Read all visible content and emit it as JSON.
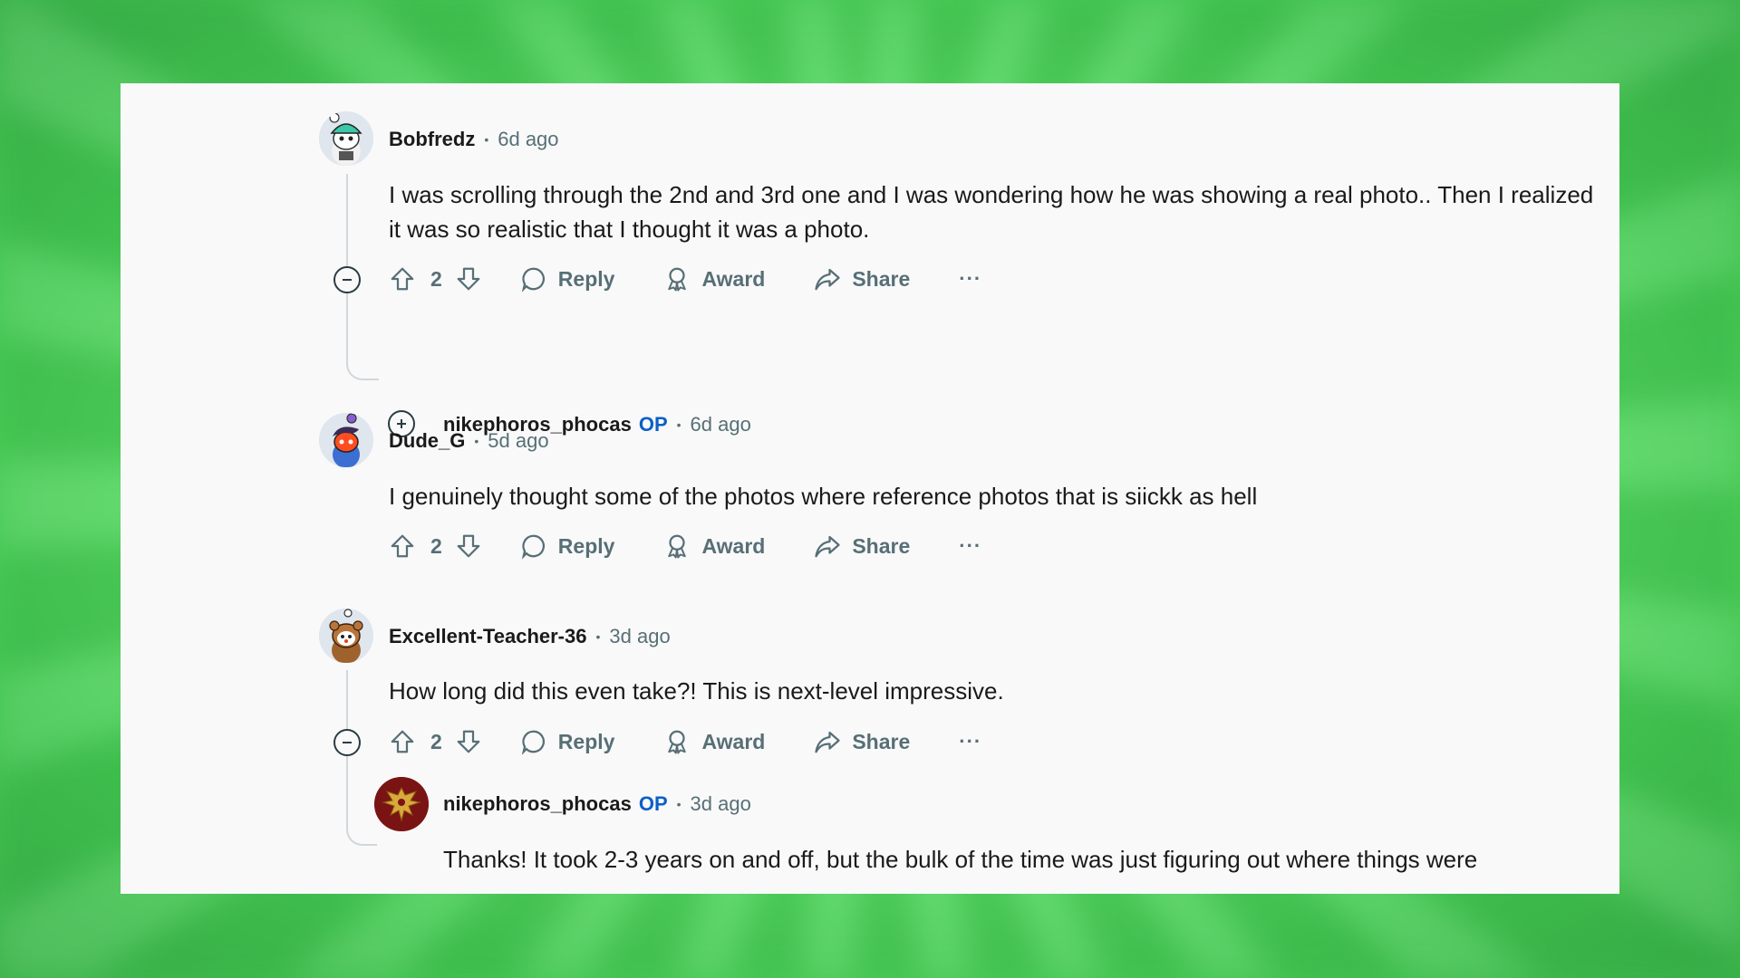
{
  "comments": [
    {
      "username": "Bobfredz",
      "time": "6d ago",
      "text": "I was scrolling through the 2nd and 3rd one and I was wondering how he was showing a real photo.. Then I realized it was so realistic that I thought it was a photo.",
      "votes": "2",
      "avatar_icon": "snoo-avatar-teal-hat-icon"
    },
    {
      "username": "nikephoros_phocas",
      "op_label": "OP",
      "time": "6d ago",
      "collapsed": true
    },
    {
      "username": "Dude_G",
      "time": "5d ago",
      "text": "I genuinely thought some of the photos where reference photos that is siickk as hell",
      "votes": "2",
      "avatar_icon": "snoo-avatar-purple-hair-icon"
    },
    {
      "username": "Excellent-Teacher-36",
      "time": "3d ago",
      "text": "How long did this even take?! This is next-level impressive.",
      "votes": "2",
      "avatar_icon": "snoo-avatar-bear-costume-icon"
    },
    {
      "username": "nikephoros_phocas",
      "op_label": "OP",
      "time": "3d ago",
      "text": "Thanks! It took 2-3 years on and off, but the bulk of the time was just figuring out where things were",
      "avatar_icon": "golden-eagle-emblem-icon"
    }
  ],
  "actions": {
    "reply_label": "Reply",
    "award_label": "Award",
    "share_label": "Share",
    "more_label": "···"
  },
  "colors": {
    "background_green": "#62e56b",
    "panel": "#f9f9fa",
    "op_blue": "#0b60c6",
    "meta_gray": "#576f76"
  }
}
